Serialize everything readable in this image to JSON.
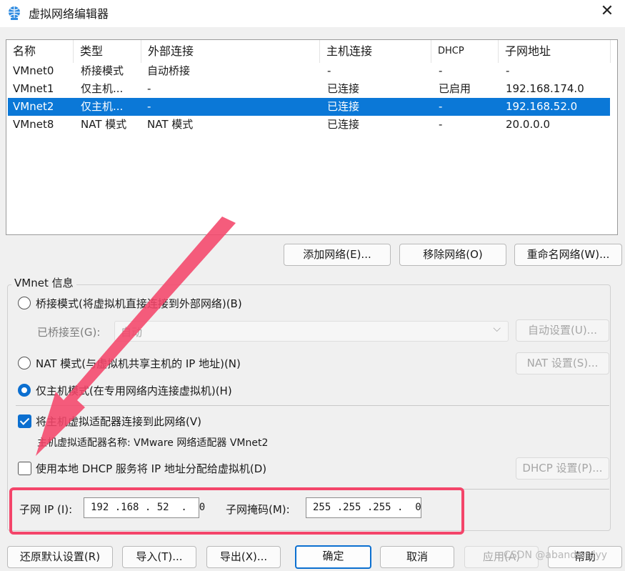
{
  "window": {
    "title": "虚拟网络编辑器",
    "app_icon": "network-globe-icon",
    "close_icon": "close-icon"
  },
  "list": {
    "headers": [
      "名称",
      "类型",
      "外部连接",
      "主机连接",
      "DHCP",
      "子网地址"
    ],
    "rows": [
      [
        "VMnet0",
        "桥接模式",
        "自动桥接",
        "-",
        "-",
        "-"
      ],
      [
        "VMnet1",
        "仅主机...",
        "-",
        "已连接",
        "已启用",
        "192.168.174.0"
      ],
      [
        "VMnet2",
        "仅主机...",
        "-",
        "已连接",
        "-",
        "192.168.52.0"
      ],
      [
        "VMnet8",
        "NAT 模式",
        "NAT 模式",
        "已连接",
        "-",
        "20.0.0.0"
      ]
    ],
    "selected_row": 2
  },
  "list_buttons": {
    "add": "添加网络(E)...",
    "remove": "移除网络(O)",
    "rename": "重命名网络(W)..."
  },
  "vmnet_info": {
    "group_label": "VMnet 信息",
    "bridged_label": "桥接模式(将虚拟机直接连接到外部网络)(B)",
    "bridged_to_label": "已桥接至(G):",
    "bridged_to_value": "自动",
    "auto_settings_button": "自动设置(U)...",
    "nat_label": "NAT 模式(与虚拟机共享主机的 IP 地址)(N)",
    "nat_settings_button": "NAT 设置(S)...",
    "hostonly_label": "仅主机模式(在专用网络内连接虚拟机)(H)",
    "selected_mode": "host-only",
    "connect_adapter_label": "将主机虚拟适配器连接到此网络(V)",
    "connect_adapter_checked": true,
    "adapter_name_label": "主机虚拟适配器名称: VMware 网络适配器 VMnet2",
    "dhcp_label": "使用本地 DHCP 服务将 IP 地址分配给虚拟机(D)",
    "dhcp_checked": false,
    "dhcp_settings_button": "DHCP 设置(P)...",
    "subnet_ip_label": "子网 IP (I):",
    "subnet_ip_value": "192 .168 . 52  .  0",
    "subnet_mask_label": "子网掩码(M):",
    "subnet_mask_value": "255 .255 .255 .  0"
  },
  "footer_buttons": {
    "restore": "还原默认设置(R)",
    "import": "导入(T)...",
    "export": "导出(X)...",
    "ok": "确定",
    "cancel": "取消",
    "apply": "应用(A)",
    "help": "帮助"
  },
  "watermark": "CSDN @abandondyy",
  "colors": {
    "selection": "#0b78d7",
    "accent": "#0b6fd0",
    "annotation": "#f4456a"
  }
}
